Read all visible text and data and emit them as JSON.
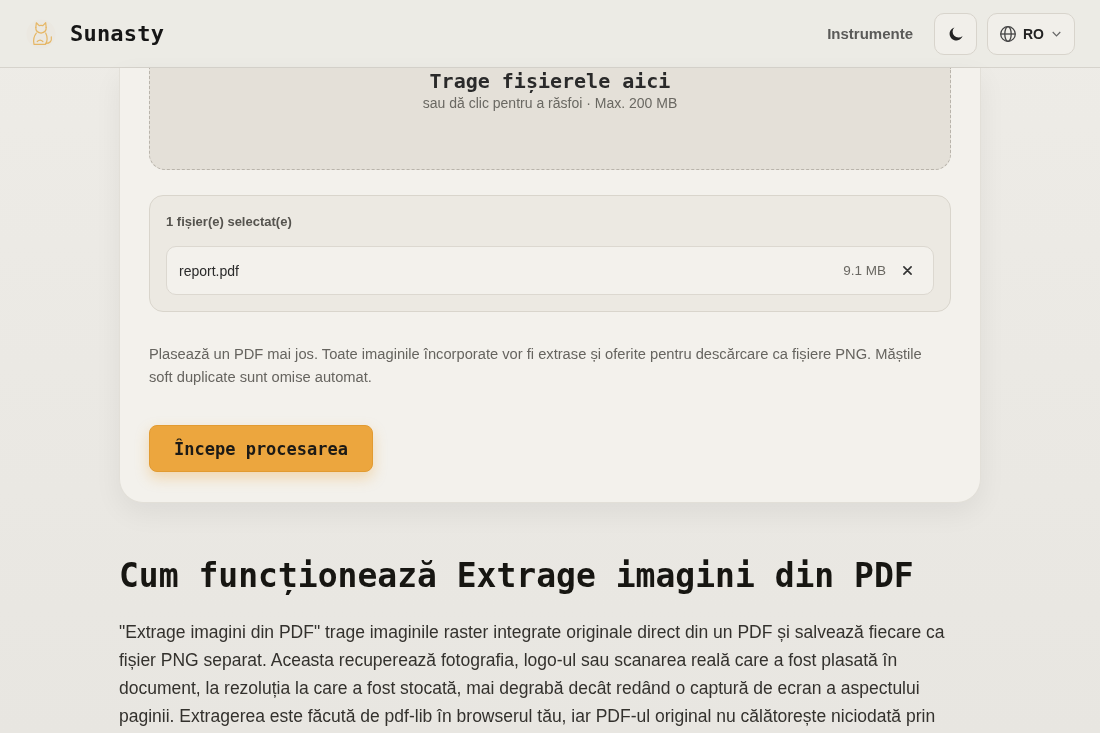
{
  "header": {
    "brand": "Sunasty",
    "nav": [
      {
        "label": "Instrumente"
      }
    ],
    "language": "RO"
  },
  "upload": {
    "drop_zone": {
      "title": "Trage fișierele aici",
      "hint": "sau dă clic pentru a răsfoi · Max. 200 MB"
    },
    "selected_files": {
      "label": "1 fișier(e) selectat(e)",
      "files": [
        {
          "name": "report.pdf",
          "size": "9.1 MB"
        }
      ]
    },
    "description": "Plasează un PDF mai jos. Toate imaginile încorporate vor fi extrase și oferite pentru descărcare ca fișiere PNG. Măștile soft duplicate sunt omise automat.",
    "start_button": "Începe procesarea"
  },
  "article": {
    "heading": "Cum funcționează Extrage imagini din PDF",
    "paragraph": "\"Extrage imagini din PDF\" trage imaginile raster integrate originale direct din un PDF și salvează fiecare ca fișier PNG separat. Aceasta recuperează fotografia, logo-ul sau scanarea reală care a fost plasată în document, la rezoluția la care a fost stocată, mai degrabă decât redând o captură de ecran a aspectului paginii. Extragerea este făcută de pdf-lib în browserul tău, iar PDF-ul original nu călătorește niciodată prin"
  }
}
